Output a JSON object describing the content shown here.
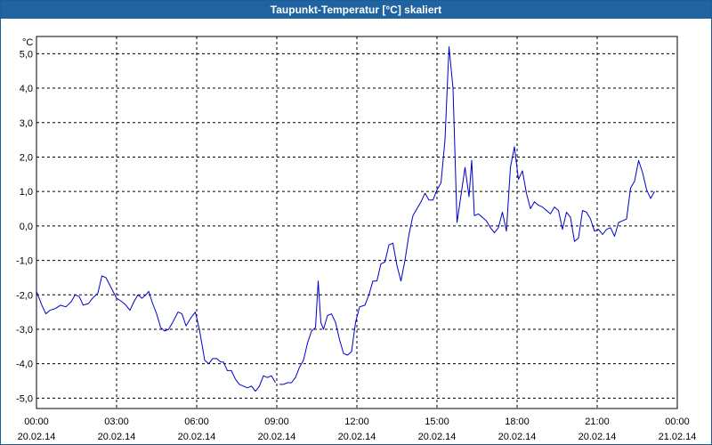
{
  "window": {
    "title": "Taupunkt-Temperatur [°C] skaliert"
  },
  "colors": {
    "titlebar": "#1f64a0",
    "series": "#0000c8",
    "grid": "#000000",
    "background": "#ffffff"
  },
  "chart_data": {
    "type": "line",
    "title": "Taupunkt-Temperatur [°C] skaliert",
    "unit": "°C",
    "xlabel": "",
    "ylabel": "",
    "grid": true,
    "ylim": [
      -5.3,
      5.5
    ],
    "xlim": [
      "20.02.14 00:00",
      "21.02.14 00:00"
    ],
    "y_ticks": [
      "5,0",
      "4,0",
      "3,0",
      "2,0",
      "1,0",
      "0,0",
      "-1,0",
      "-2,0",
      "-3,0",
      "-4,0",
      "-5,0"
    ],
    "y_tick_values": [
      5,
      4,
      3,
      2,
      1,
      0,
      -1,
      -2,
      -3,
      -4,
      -5
    ],
    "x_ticks": [
      {
        "time": "00:00",
        "date": "20.02.14",
        "hour": 0
      },
      {
        "time": "03:00",
        "date": "20.02.14",
        "hour": 3
      },
      {
        "time": "06:00",
        "date": "20.02.14",
        "hour": 6
      },
      {
        "time": "09:00",
        "date": "20.02.14",
        "hour": 9
      },
      {
        "time": "12:00",
        "date": "20.02.14",
        "hour": 12
      },
      {
        "time": "15:00",
        "date": "20.02.14",
        "hour": 15
      },
      {
        "time": "18:00",
        "date": "20.02.14",
        "hour": 18
      },
      {
        "time": "21:00",
        "date": "20.02.14",
        "hour": 21
      },
      {
        "time": "00:00",
        "date": "21.02.14",
        "hour": 24
      }
    ],
    "series": [
      {
        "color": "#0000c8",
        "segments": [
          [
            [
              0.0,
              -1.9
            ],
            [
              0.2,
              -2.3
            ],
            [
              0.35,
              -2.55
            ],
            [
              0.5,
              -2.45
            ],
            [
              0.7,
              -2.4
            ],
            [
              0.9,
              -2.3
            ],
            [
              1.1,
              -2.35
            ],
            [
              1.3,
              -2.2
            ],
            [
              1.45,
              -2.0
            ],
            [
              1.6,
              -2.05
            ],
            [
              1.75,
              -2.3
            ],
            [
              1.95,
              -2.25
            ],
            [
              2.1,
              -2.1
            ],
            [
              2.3,
              -1.95
            ],
            [
              2.45,
              -1.45
            ],
            [
              2.6,
              -1.5
            ],
            [
              2.8,
              -1.8
            ],
            [
              3.0,
              -2.1
            ],
            [
              3.2,
              -2.2
            ],
            [
              3.35,
              -2.3
            ],
            [
              3.5,
              -2.45
            ],
            [
              3.65,
              -2.2
            ],
            [
              3.8,
              -2.0
            ],
            [
              3.95,
              -2.1
            ],
            [
              4.1,
              -2.0
            ],
            [
              4.2,
              -1.9
            ],
            [
              4.35,
              -2.25
            ],
            [
              4.5,
              -2.55
            ],
            [
              4.65,
              -2.95
            ],
            [
              4.8,
              -3.05
            ],
            [
              4.95,
              -3.0
            ],
            [
              5.1,
              -2.8
            ],
            [
              5.3,
              -2.5
            ],
            [
              5.45,
              -2.55
            ],
            [
              5.6,
              -2.9
            ],
            [
              5.8,
              -2.65
            ],
            [
              5.95,
              -2.5
            ],
            [
              6.1,
              -3.0
            ],
            [
              6.3,
              -3.9
            ],
            [
              6.45,
              -4.0
            ],
            [
              6.6,
              -3.85
            ],
            [
              6.75,
              -3.85
            ],
            [
              6.9,
              -3.95
            ],
            [
              7.0,
              -3.95
            ],
            [
              7.15,
              -4.2
            ],
            [
              7.3,
              -4.2
            ],
            [
              7.45,
              -4.45
            ],
            [
              7.6,
              -4.6
            ],
            [
              7.75,
              -4.65
            ],
            [
              7.9,
              -4.7
            ],
            [
              8.05,
              -4.65
            ],
            [
              8.2,
              -4.8
            ],
            [
              8.35,
              -4.65
            ],
            [
              8.5,
              -4.35
            ],
            [
              8.65,
              -4.4
            ],
            [
              8.8,
              -4.35
            ],
            [
              8.95,
              -4.55
            ]
          ],
          [
            [
              9.1,
              -4.6
            ],
            [
              9.25,
              -4.6
            ],
            [
              9.4,
              -4.55
            ],
            [
              9.55,
              -4.55
            ],
            [
              9.7,
              -4.4
            ],
            [
              9.85,
              -4.1
            ],
            [
              10.0,
              -3.9
            ],
            [
              10.15,
              -3.4
            ],
            [
              10.3,
              -3.05
            ],
            [
              10.45,
              -2.95
            ],
            [
              10.55,
              -1.6
            ],
            [
              10.65,
              -2.8
            ],
            [
              10.75,
              -3.0
            ],
            [
              10.9,
              -2.6
            ],
            [
              11.05,
              -2.55
            ],
            [
              11.2,
              -2.8
            ],
            [
              11.35,
              -3.3
            ],
            [
              11.5,
              -3.7
            ],
            [
              11.65,
              -3.75
            ],
            [
              11.8,
              -3.65
            ],
            [
              11.95,
              -2.8
            ],
            [
              12.1,
              -2.35
            ],
            [
              12.3,
              -2.3
            ],
            [
              12.45,
              -2.0
            ],
            [
              12.6,
              -1.6
            ],
            [
              12.75,
              -1.6
            ],
            [
              12.9,
              -1.1
            ],
            [
              13.05,
              -1.05
            ],
            [
              13.2,
              -0.55
            ],
            [
              13.35,
              -0.5
            ],
            [
              13.5,
              -1.15
            ],
            [
              13.65,
              -1.6
            ],
            [
              13.8,
              -1.0
            ],
            [
              13.95,
              -0.25
            ],
            [
              14.1,
              0.3
            ],
            [
              14.25,
              0.5
            ],
            [
              14.4,
              0.7
            ],
            [
              14.55,
              0.95
            ],
            [
              14.7,
              0.75
            ],
            [
              14.85,
              0.75
            ],
            [
              15.0,
              1.05
            ],
            [
              15.15,
              1.25
            ],
            [
              15.3,
              2.5
            ],
            [
              15.45,
              5.2
            ],
            [
              15.6,
              4.0
            ],
            [
              15.75,
              0.1
            ],
            [
              15.9,
              0.9
            ],
            [
              16.05,
              1.7
            ],
            [
              16.2,
              0.85
            ],
            [
              16.3,
              1.9
            ],
            [
              16.4,
              0.3
            ],
            [
              16.55,
              0.35
            ],
            [
              16.7,
              0.25
            ],
            [
              16.85,
              0.15
            ],
            [
              17.0,
              -0.05
            ],
            [
              17.15,
              -0.2
            ],
            [
              17.3,
              -0.05
            ],
            [
              17.45,
              0.4
            ],
            [
              17.6,
              -0.15
            ],
            [
              17.75,
              1.7
            ],
            [
              17.9,
              2.3
            ],
            [
              18.05,
              1.35
            ],
            [
              18.2,
              1.6
            ],
            [
              18.35,
              0.95
            ],
            [
              18.5,
              0.5
            ],
            [
              18.65,
              0.7
            ],
            [
              18.8,
              0.6
            ],
            [
              18.95,
              0.55
            ],
            [
              19.1,
              0.45
            ],
            [
              19.25,
              0.35
            ],
            [
              19.4,
              0.55
            ],
            [
              19.55,
              0.45
            ],
            [
              19.7,
              -0.1
            ],
            [
              19.85,
              0.4
            ],
            [
              20.0,
              0.25
            ],
            [
              20.15,
              -0.45
            ],
            [
              20.3,
              -0.35
            ],
            [
              20.45,
              0.45
            ],
            [
              20.6,
              0.4
            ],
            [
              20.75,
              0.2
            ],
            [
              20.9,
              -0.15
            ],
            [
              21.05,
              -0.1
            ],
            [
              21.2,
              -0.25
            ],
            [
              21.35,
              -0.1
            ],
            [
              21.5,
              -0.05
            ],
            [
              21.65,
              -0.3
            ],
            [
              21.8,
              0.1
            ],
            [
              21.95,
              0.15
            ],
            [
              22.1,
              0.2
            ],
            [
              22.25,
              1.1
            ],
            [
              22.4,
              1.3
            ],
            [
              22.55,
              1.9
            ],
            [
              22.7,
              1.55
            ],
            [
              22.85,
              1.05
            ],
            [
              23.0,
              0.8
            ],
            [
              23.15,
              1.0
            ]
          ]
        ]
      }
    ]
  }
}
